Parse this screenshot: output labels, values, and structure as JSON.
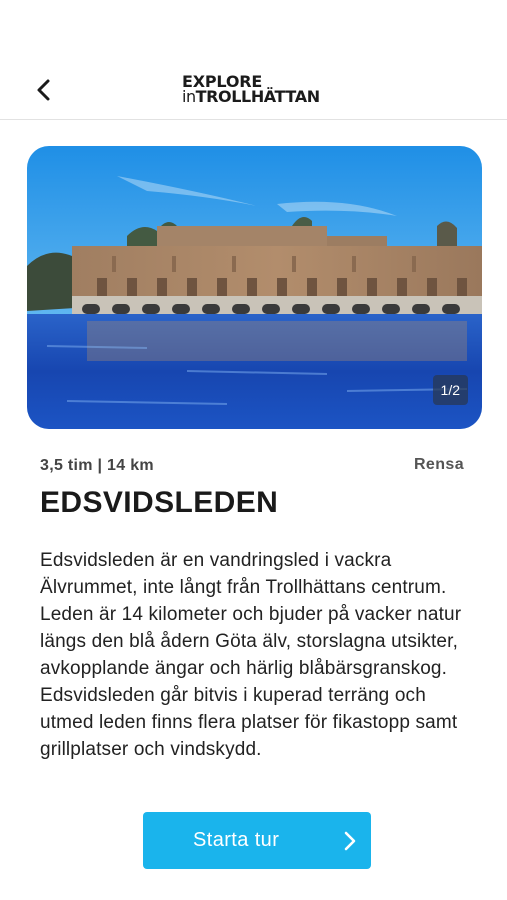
{
  "header": {
    "logo_line1": "EXPLORE",
    "logo_in": "in",
    "logo_city": "TROLLHÄTTAN",
    "back_icon": "chevron-left-icon"
  },
  "gallery": {
    "counter": "1/2"
  },
  "trail": {
    "meta": "3,5 tim | 14 km",
    "clear_label": "Rensa",
    "title": "EDSVIDSLEDEN",
    "description": "Edsvidsleden är en vandringsled i vackra Älvrummet, inte långt från Trollhättans centrum. Leden är 14 kilometer och bjuder på vacker natur längs den blå ådern Göta älv, storslagna utsikter, avkopplande ängar och härlig blåbärsgranskog. Edsvidsleden går bitvis i kuperad terräng och utmed leden finns flera platser för fikastopp samt grillplatser och vindskydd."
  },
  "actions": {
    "start_label": "Starta tur",
    "start_icon": "chevron-right-icon"
  },
  "colors": {
    "accent": "#1ab4ec",
    "text": "#1f1f1f"
  }
}
